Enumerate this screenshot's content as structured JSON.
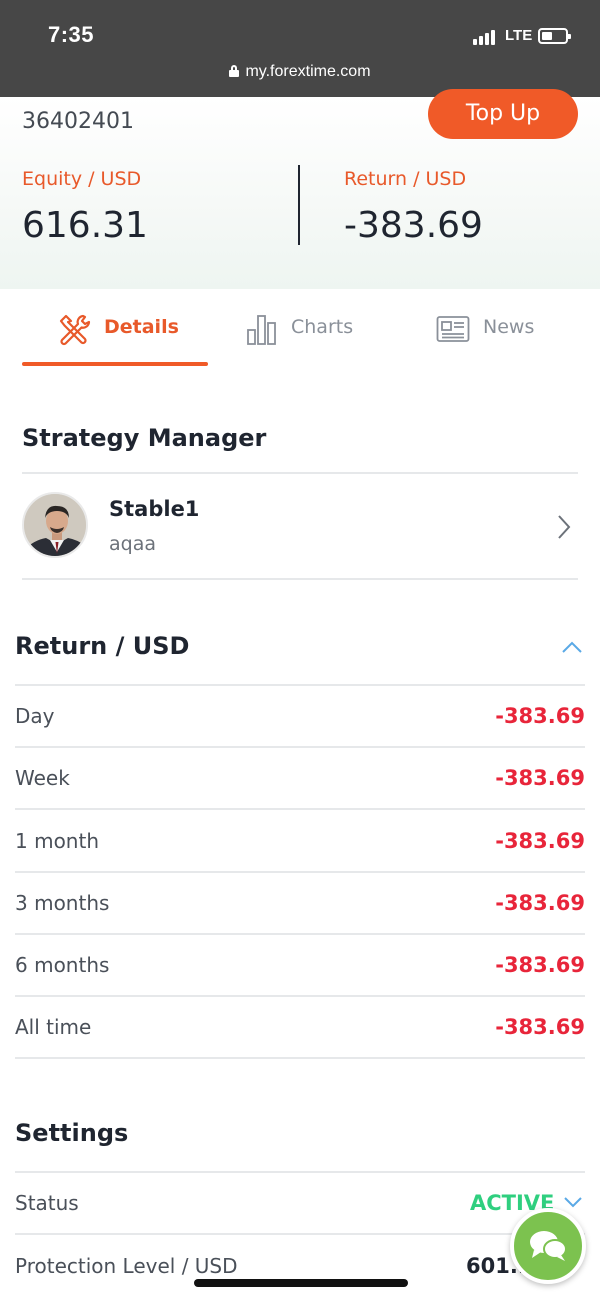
{
  "status_bar": {
    "time": "7:35",
    "network": "LTE",
    "url": "my.forextime.com"
  },
  "account": {
    "number": "36402401",
    "top_up_label": "Top Up",
    "equity_label": "Equity / USD",
    "equity_value": "616.31",
    "return_label": "Return / USD",
    "return_value": "-383.69"
  },
  "tabs": [
    {
      "label": "Details",
      "icon": "tools-icon",
      "active": true
    },
    {
      "label": "Charts",
      "icon": "bar-chart-icon",
      "active": false
    },
    {
      "label": "News",
      "icon": "newspaper-icon",
      "active": false
    }
  ],
  "strategy_manager": {
    "title": "Strategy Manager",
    "name": "Stable1",
    "subtitle": "aqaa"
  },
  "returns": {
    "title": "Return / USD",
    "rows": [
      {
        "label": "Day",
        "value": "-383.69"
      },
      {
        "label": "Week",
        "value": "-383.69"
      },
      {
        "label": "1 month",
        "value": "-383.69"
      },
      {
        "label": "3 months",
        "value": "-383.69"
      },
      {
        "label": "6 months",
        "value": "-383.69"
      },
      {
        "label": "All time",
        "value": "-383.69"
      }
    ]
  },
  "settings": {
    "title": "Settings",
    "status_label": "Status",
    "status_value": "ACTIVE",
    "protection_label": "Protection Level / USD",
    "protection_value": "601.."
  },
  "colors": {
    "accent": "#f05a28",
    "negative": "#e8253a",
    "active": "#2fcf7f",
    "chat": "#7cc24f"
  }
}
